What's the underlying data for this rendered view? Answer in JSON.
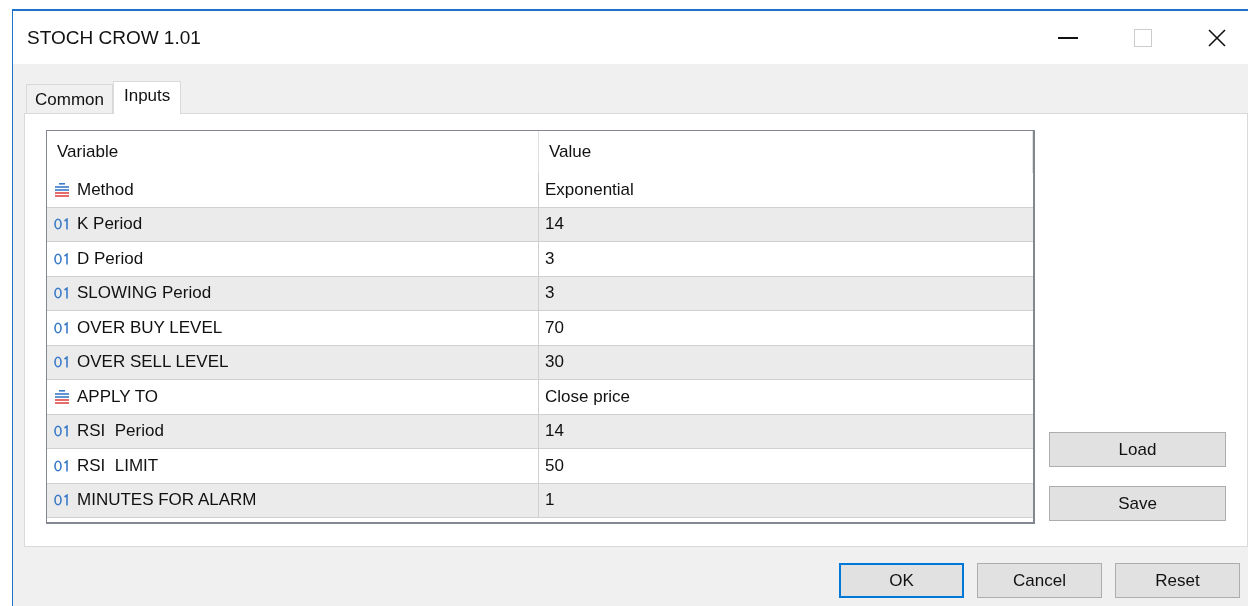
{
  "window": {
    "title": "STOCH CROW 1.01"
  },
  "tabs": [
    {
      "label": "Common",
      "selected": false
    },
    {
      "label": "Inputs",
      "selected": true
    }
  ],
  "table": {
    "columns": [
      "Variable",
      "Value"
    ],
    "rows": [
      {
        "kind": "enum",
        "variable": "Method",
        "value": "Exponential"
      },
      {
        "kind": "integer",
        "variable": "K Period",
        "value": "14"
      },
      {
        "kind": "integer",
        "variable": "D Period",
        "value": "3"
      },
      {
        "kind": "integer",
        "variable": "SLOWING Period",
        "value": "3"
      },
      {
        "kind": "integer",
        "variable": "OVER BUY LEVEL",
        "value": "70"
      },
      {
        "kind": "integer",
        "variable": "OVER SELL LEVEL",
        "value": "30"
      },
      {
        "kind": "enum",
        "variable": "APPLY TO",
        "value": "Close price"
      },
      {
        "kind": "integer",
        "variable": "RSI  Period",
        "value": "14"
      },
      {
        "kind": "integer",
        "variable": "RSI  LIMIT",
        "value": "50"
      },
      {
        "kind": "integer",
        "variable": "MINUTES FOR ALARM",
        "value": "1"
      }
    ]
  },
  "side_buttons": [
    "Load",
    "Save"
  ],
  "buttons": [
    {
      "label": "OK",
      "selected": true
    },
    {
      "label": "Cancel",
      "selected": false
    },
    {
      "label": "Reset",
      "selected": false
    }
  ]
}
